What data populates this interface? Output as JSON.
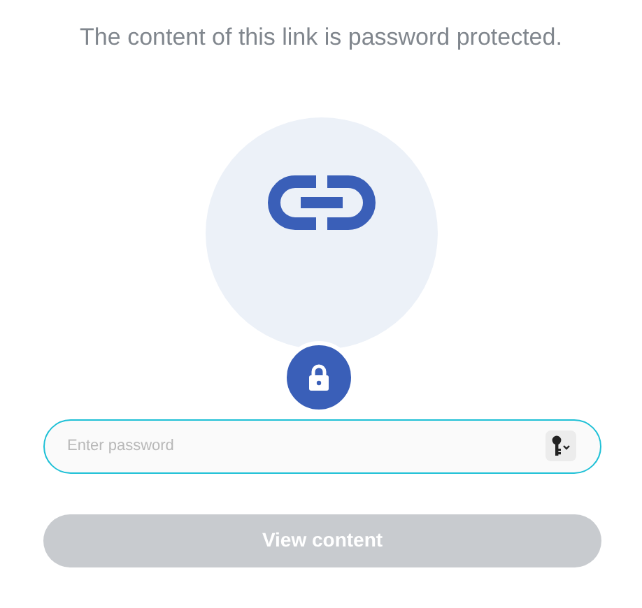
{
  "message": "The content of this link is password protected.",
  "password_field": {
    "placeholder": "Enter password"
  },
  "submit_button": {
    "label": "View content",
    "disabled": true
  }
}
